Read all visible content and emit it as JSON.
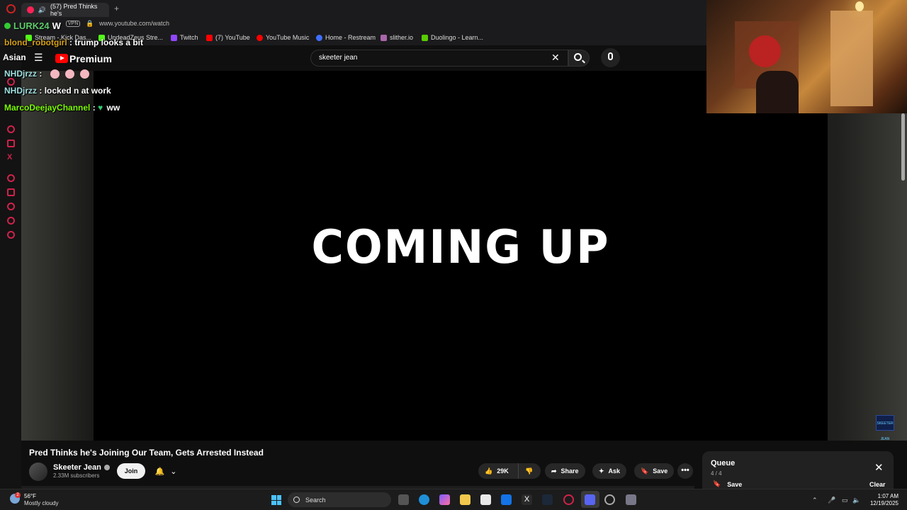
{
  "browser": {
    "tab_title": "(57) Pred Thinks he's",
    "new_tab": "+",
    "vpn": "VPN",
    "url": "www.youtube.com/watch",
    "bookmarks": [
      {
        "label": "Stream - Kick Das...",
        "color": "#53fc18"
      },
      {
        "label": "UndeadZeus Stre...",
        "color": "#53fc18"
      },
      {
        "label": "Twitch",
        "color": "#9146ff"
      },
      {
        "label": "(7) YouTube",
        "color": "#ff0000"
      },
      {
        "label": "YouTube Music",
        "color": "#ff0000"
      },
      {
        "label": "Home - Restream",
        "color": "#3f6fff"
      },
      {
        "label": "slither.io",
        "color": "#aa66aa"
      },
      {
        "label": "Duolingo - Learn...",
        "color": "#58cc02"
      }
    ]
  },
  "overlay": {
    "lurk": "LURK24",
    "lurk_suffix": "W",
    "asian": "Asian",
    "chat": [
      {
        "user": "blond_robotgirl",
        "color": "#d4a017",
        "msg": ": trump looks a bit"
      },
      {
        "user": "NHDjrzz",
        "color": "#9fe0e0",
        "msg": ":"
      },
      {
        "user": "NHDjrzz",
        "color": "#9fe0e0",
        "msg": ": locked n at work"
      },
      {
        "user": "MarcoDeejayChannel",
        "color": "#7cfc00",
        "msg": "ww"
      }
    ]
  },
  "youtube": {
    "premium": "Premium",
    "search_value": "skeeter jean",
    "video_text": "COMING UP",
    "corner_logo": "SKEETER JEAN",
    "title": "Pred Thinks he's Joining Our Team, Gets Arrested Instead",
    "channel": "Skeeter Jean",
    "subscribers": "2.33M subscribers",
    "join": "Join",
    "likes": "29K",
    "share": "Share",
    "ask": "Ask",
    "save": "Save",
    "more": "•••",
    "queue": {
      "title": "Queue",
      "count": "4 / 4",
      "save": "Save",
      "clear": "Clear"
    }
  },
  "taskbar": {
    "temp": "56°F",
    "condition": "Mostly cloudy",
    "weather_badge": "2",
    "search": "Search",
    "time": "1:07 AM",
    "date": "12/19/2025"
  },
  "colors": {
    "accent_red": "#ff0000",
    "windows_blue": "#4cc2ff"
  }
}
